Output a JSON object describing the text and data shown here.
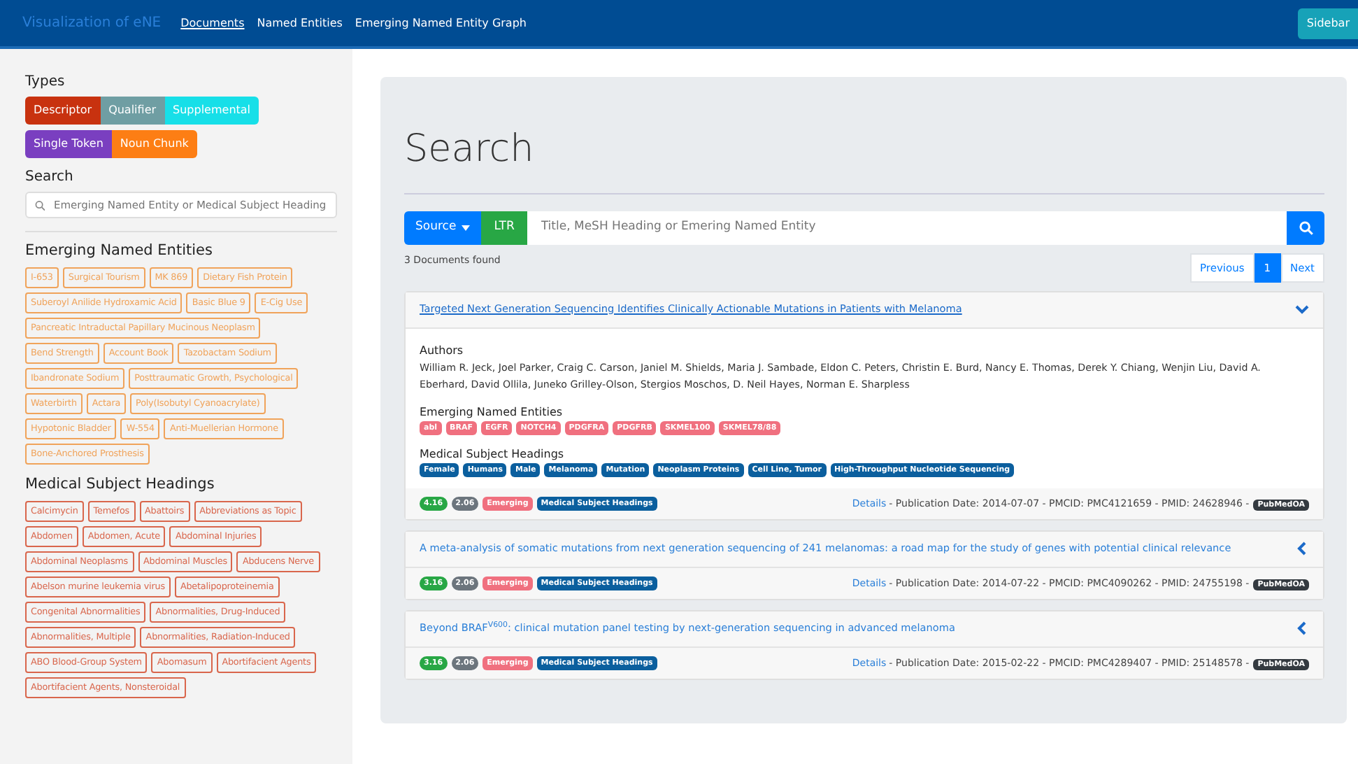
{
  "navbar": {
    "brand": "Visualization of eNE",
    "links": [
      {
        "label": "Documents",
        "selected": true
      },
      {
        "label": "Named Entities",
        "selected": false
      },
      {
        "label": "Emerging Named Entity Graph",
        "selected": false
      }
    ],
    "sidebar_button": "Sidebar"
  },
  "sidebar": {
    "types_heading": "Types",
    "type_rows": [
      [
        {
          "label": "Descriptor",
          "color": "#c8320f"
        },
        {
          "label": "Qualifier",
          "color": "#6f9ea3"
        },
        {
          "label": "Supplemental",
          "color": "#17dfe8"
        }
      ],
      [
        {
          "label": "Single Token",
          "color": "#7a3fc0"
        },
        {
          "label": "Noun Chunk",
          "color": "#fd7e14"
        }
      ]
    ],
    "search_heading": "Search",
    "search_placeholder": "Emerging Named Entity or Medical Subject Heading",
    "groups": [
      {
        "heading": "Emerging Named Entities",
        "color": "#f0a35a",
        "tags": [
          "I-653",
          "Surgical Tourism",
          "MK 869",
          "Dietary Fish Protein",
          "Suberoyl Anilide Hydroxamic Acid",
          "Basic Blue 9",
          "E-Cig Use",
          "Pancreatic Intraductal Papillary Mucinous Neoplasm",
          "Bend Strength",
          "Account Book",
          "Tazobactam Sodium",
          "Ibandronate Sodium",
          "Posttraumatic Growth, Psychological",
          "Waterbirth",
          "Actara",
          "Poly(Isobutyl Cyanoacrylate)",
          "Hypotonic Bladder",
          "W-554",
          "Anti-Muellerian Hormone",
          "Bone-Anchored Prosthesis"
        ]
      },
      {
        "heading": "Medical Subject Headings",
        "color": "#d9664c",
        "tags": [
          "Calcimycin",
          "Temefos",
          "Abattoirs",
          "Abbreviations as Topic",
          "Abdomen",
          "Abdomen, Acute",
          "Abdominal Injuries",
          "Abdominal Neoplasms",
          "Abdominal Muscles",
          "Abducens Nerve",
          "Abelson murine leukemia virus",
          "Abetalipoproteinemia",
          "Congenital Abnormalities",
          "Abnormalities, Drug-Induced",
          "Abnormalities, Multiple",
          "Abnormalities, Radiation-Induced",
          "ABO Blood-Group System",
          "Abomasum",
          "Abortifacient Agents",
          "Abortifacient Agents, Nonsteroidal"
        ]
      }
    ]
  },
  "main": {
    "title": "Search",
    "source_button": "Source",
    "ltr_button": "LTR",
    "search_placeholder": "Title, MeSH Heading or Emering Named Entity",
    "results_count": "3 Documents found",
    "pagination": [
      {
        "label": "Previous",
        "selected": false
      },
      {
        "label": "1",
        "selected": true
      },
      {
        "label": "Next",
        "selected": false
      }
    ],
    "documents": [
      {
        "title": "Targeted Next Generation Sequencing Identifies Clinically Actionable Mutations in Patients with Melanoma",
        "expanded": true,
        "authors_heading": "Authors",
        "authors": "William R. Jeck, Joel Parker, Craig C. Carson, Janiel M. Shields, Maria J. Sambade, Eldon C. Peters, Christin E. Burd, Nancy E. Thomas, Derek Y. Chiang, Wenjin Liu, David A. Eberhard, David Ollila, Juneko Grilley-Olson, Stergios Moschos, D. Neil Hayes, Norman E. Sharpless",
        "entities_heading": "Emerging Named Entities",
        "entities": [
          "abl",
          "BRAF",
          "EGFR",
          "NOTCH4",
          "PDGFRA",
          "PDGFRB",
          "SKMEL100",
          "SKMEL78/88"
        ],
        "mesh_heading": "Medical Subject Headings",
        "mesh": [
          "Female",
          "Humans",
          "Male",
          "Melanoma",
          "Mutation",
          "Neoplasm Proteins",
          "Cell Line, Tumor",
          "High-Throughput Nucleotide Sequencing"
        ],
        "badges": [
          {
            "kind": "score",
            "text": "4.16"
          },
          {
            "kind": "weight",
            "text": "2.06"
          },
          {
            "kind": "emerging",
            "text": "Emerging"
          },
          {
            "kind": "mesh",
            "text": "Medical Subject Headings"
          }
        ],
        "details": "Details",
        "meta": "- Publication Date: 2014-07-07 - PMCID: PMC4121659 - PMID: 24628946 -",
        "source": "PubMedOA"
      },
      {
        "title": "A meta-analysis of somatic mutations from next generation sequencing of 241 melanomas: a road map for the study of genes with potential clinical relevance",
        "expanded": false,
        "badges": [
          {
            "kind": "score",
            "text": "3.16"
          },
          {
            "kind": "weight",
            "text": "2.06"
          },
          {
            "kind": "emerging",
            "text": "Emerging"
          },
          {
            "kind": "mesh",
            "text": "Medical Subject Headings"
          }
        ],
        "details": "Details",
        "meta": "- Publication Date: 2014-07-22 - PMCID: PMC4090262 - PMID: 24755198 -",
        "source": "PubMedOA"
      },
      {
        "title": "Beyond BRAF$^{V600}$: clinical mutation panel testing by next-generation sequencing in advanced melanoma",
        "expanded": false,
        "badges": [
          {
            "kind": "score",
            "text": "3.16"
          },
          {
            "kind": "weight",
            "text": "2.06"
          },
          {
            "kind": "emerging",
            "text": "Emerging"
          },
          {
            "kind": "mesh",
            "text": "Medical Subject Headings"
          }
        ],
        "details": "Details",
        "meta": "- Publication Date: 2015-02-22 - PMCID: PMC4289407 - PMID: 25148578 -",
        "source": "PubMedOA"
      }
    ]
  }
}
